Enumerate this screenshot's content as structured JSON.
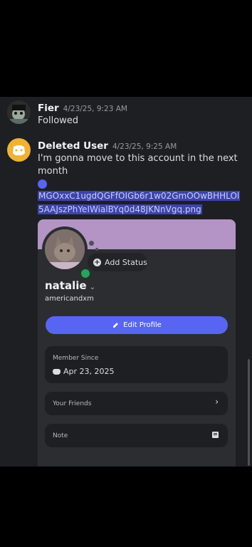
{
  "messages": [
    {
      "author": "Fier",
      "timestamp": "4/23/25, 9:23 AM",
      "text": "Followed"
    },
    {
      "author": "Deleted User",
      "timestamp": "4/23/25, 9:25 AM",
      "text_line1": "I'm gonna move to this account in the next",
      "text_line2": "month",
      "attachment": {
        "filename_line1": "MGOxxC1ugdQGFfOIGb6r1w02GmOOwBHHLOl",
        "filename_line2": "5AAJszPhYeIWialBYq0d48JKNnVgq.png"
      }
    }
  ],
  "profile": {
    "add_status": "Add Status",
    "display_name": "natalie",
    "username": "americandxm",
    "edit_button": "Edit Profile",
    "member_since_label": "Member Since",
    "member_since_value": "Apr 23, 2025",
    "friends_label": "Your Friends",
    "note_label": "Note"
  },
  "colors": {
    "accent": "#5865f2",
    "online": "#23a55a",
    "banner": "#b394c4",
    "discord_avatar": "#f0b232"
  }
}
